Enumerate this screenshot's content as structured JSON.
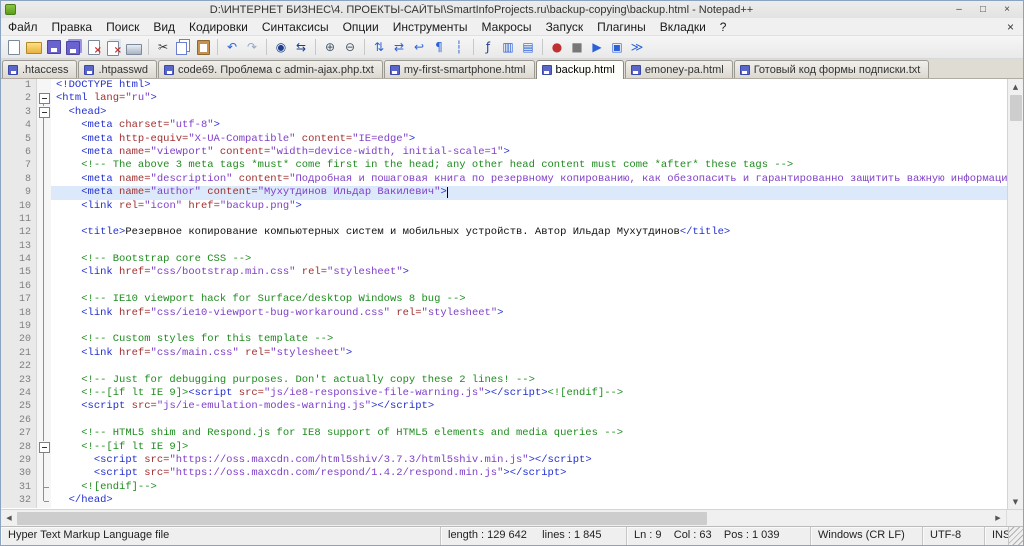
{
  "window": {
    "title": "D:\\ИНТЕРНЕТ БИЗНЕС\\4. ПРОЕКТЫ-САЙТЫ\\SmartInfoProjects.ru\\backup-copying\\backup.html - Notepad++",
    "controls": {
      "minimize": "–",
      "maximize": "□",
      "close": "×"
    }
  },
  "menu": {
    "items": [
      "Файл",
      "Правка",
      "Поиск",
      "Вид",
      "Кодировки",
      "Синтаксисы",
      "Опции",
      "Инструменты",
      "Макросы",
      "Запуск",
      "Плагины",
      "Вкладки",
      "?"
    ],
    "close_label": "×"
  },
  "toolbar": {
    "icons": [
      {
        "name": "new-file-icon",
        "type": "file"
      },
      {
        "name": "open-file-icon",
        "type": "folder"
      },
      {
        "name": "save-icon",
        "type": "floppy"
      },
      {
        "name": "save-all-icon",
        "type": "floppy-all"
      },
      {
        "name": "close-file-icon",
        "type": "file-close"
      },
      {
        "name": "close-all-icon",
        "type": "file-close-all"
      },
      {
        "name": "print-icon",
        "type": "printer"
      },
      {
        "type": "sep"
      },
      {
        "name": "cut-icon",
        "type": "glyph",
        "glyph": "✂",
        "color": "#3a3a3a"
      },
      {
        "name": "copy-icon",
        "type": "copy"
      },
      {
        "name": "paste-icon",
        "type": "clipboard"
      },
      {
        "type": "sep"
      },
      {
        "name": "undo-icon",
        "type": "glyph",
        "glyph": "↶",
        "color": "#2b62d9"
      },
      {
        "name": "redo-icon",
        "type": "glyph",
        "glyph": "↷",
        "color": "#98a8c6"
      },
      {
        "type": "sep"
      },
      {
        "name": "find-icon",
        "type": "glyph",
        "glyph": "◉",
        "color": "#1d3f8f"
      },
      {
        "name": "replace-icon",
        "type": "glyph",
        "glyph": "⇆",
        "color": "#1d3f8f"
      },
      {
        "type": "sep"
      },
      {
        "name": "zoom-in-icon",
        "type": "glyph",
        "glyph": "⊕",
        "color": "#4a5a6a"
      },
      {
        "name": "zoom-out-icon",
        "type": "glyph",
        "glyph": "⊖",
        "color": "#4a5a6a"
      },
      {
        "type": "sep"
      },
      {
        "name": "sync-vertical-icon",
        "type": "glyph",
        "glyph": "⇅",
        "color": "#2b62d9"
      },
      {
        "name": "sync-horizontal-icon",
        "type": "glyph",
        "glyph": "⇄",
        "color": "#2b62d9"
      },
      {
        "name": "word-wrap-icon",
        "type": "glyph",
        "glyph": "↩",
        "color": "#2b62d9"
      },
      {
        "name": "show-all-chars-icon",
        "type": "glyph",
        "glyph": "¶",
        "color": "#2b62d9"
      },
      {
        "name": "indent-guide-icon",
        "type": "glyph",
        "glyph": "┆",
        "color": "#2b62d9"
      },
      {
        "type": "sep"
      },
      {
        "name": "function-list-icon",
        "type": "glyph",
        "glyph": "ƒ",
        "color": "#1d3f8f"
      },
      {
        "name": "document-map-icon",
        "type": "glyph",
        "glyph": "▥",
        "color": "#2b62d9"
      },
      {
        "name": "doc-switcher-icon",
        "type": "glyph",
        "glyph": "▤",
        "color": "#2b62d9"
      },
      {
        "type": "sep"
      },
      {
        "name": "record-macro-icon",
        "type": "glyph",
        "glyph": "●",
        "color": "#c03030"
      },
      {
        "name": "stop-macro-icon",
        "type": "glyph",
        "glyph": "■",
        "color": "#777777"
      },
      {
        "name": "play-macro-icon",
        "type": "glyph",
        "glyph": "▶",
        "color": "#2b62d9"
      },
      {
        "name": "save-macro-icon",
        "type": "glyph",
        "glyph": "▣",
        "color": "#2b62d9"
      },
      {
        "name": "run-macro-multiple-icon",
        "type": "glyph",
        "glyph": "≫",
        "color": "#2b62d9"
      }
    ]
  },
  "tabs": [
    {
      "label": ".htaccess",
      "active": false
    },
    {
      "label": ".htpasswd",
      "active": false
    },
    {
      "label": "code69. Проблема с admin-ajax.php.txt",
      "active": false
    },
    {
      "label": "my-first-smartphone.html",
      "active": false
    },
    {
      "label": "backup.html",
      "active": true
    },
    {
      "label": "emoney-pa.html",
      "active": false
    },
    {
      "label": "Готовый код формы подписки.txt",
      "active": false
    }
  ],
  "editor": {
    "lines": [
      {
        "fold": "none",
        "seg": [
          [
            "t",
            "<!DOCTYPE html>"
          ]
        ]
      },
      {
        "fold": "open",
        "seg": [
          [
            "t",
            "<html "
          ],
          [
            "a",
            "lang="
          ],
          [
            "v",
            "\"ru\""
          ],
          [
            "t",
            ">"
          ]
        ]
      },
      {
        "fold": "open",
        "seg": [
          [
            "x",
            "  "
          ],
          [
            "t",
            "<head>"
          ]
        ]
      },
      {
        "fold": "line",
        "seg": [
          [
            "x",
            "    "
          ],
          [
            "t",
            "<meta "
          ],
          [
            "a",
            "charset="
          ],
          [
            "v",
            "\"utf-8\""
          ],
          [
            "t",
            ">"
          ]
        ]
      },
      {
        "fold": "line",
        "seg": [
          [
            "x",
            "    "
          ],
          [
            "t",
            "<meta "
          ],
          [
            "a",
            "http-equiv="
          ],
          [
            "v",
            "\"X-UA-Compatible\""
          ],
          [
            "x",
            " "
          ],
          [
            "a",
            "content="
          ],
          [
            "v",
            "\"IE=edge\""
          ],
          [
            "t",
            ">"
          ]
        ]
      },
      {
        "fold": "line",
        "seg": [
          [
            "x",
            "    "
          ],
          [
            "t",
            "<meta "
          ],
          [
            "a",
            "name="
          ],
          [
            "v",
            "\"viewport\""
          ],
          [
            "x",
            " "
          ],
          [
            "a",
            "content="
          ],
          [
            "v",
            "\"width=device-width, initial-scale=1\""
          ],
          [
            "t",
            ">"
          ]
        ]
      },
      {
        "fold": "line",
        "seg": [
          [
            "x",
            "    "
          ],
          [
            "c",
            "<!-- The above 3 meta tags *must* come first in the head; any other head content must come *after* these tags -->"
          ]
        ]
      },
      {
        "fold": "line",
        "seg": [
          [
            "x",
            "    "
          ],
          [
            "t",
            "<meta "
          ],
          [
            "a",
            "name="
          ],
          [
            "v",
            "\"description\""
          ],
          [
            "x",
            " "
          ],
          [
            "a",
            "content="
          ],
          [
            "v",
            "\"Подробная и пошаговая книга по резервному копированию, как обезопасить и гарантированно защитить важную информацию от внез"
          ]
        ]
      },
      {
        "fold": "line",
        "hl": true,
        "caret": true,
        "seg": [
          [
            "x",
            "    "
          ],
          [
            "t",
            "<meta "
          ],
          [
            "a",
            "name="
          ],
          [
            "v",
            "\"author\""
          ],
          [
            "x",
            " "
          ],
          [
            "a",
            "content="
          ],
          [
            "v",
            "\"Мухутдинов Ильдар Вакилевич\""
          ],
          [
            "t",
            ">"
          ]
        ]
      },
      {
        "fold": "line",
        "seg": [
          [
            "x",
            "    "
          ],
          [
            "t",
            "<link "
          ],
          [
            "a",
            "rel="
          ],
          [
            "v",
            "\"icon\""
          ],
          [
            "x",
            " "
          ],
          [
            "a",
            "href="
          ],
          [
            "v",
            "\"backup.png\""
          ],
          [
            "t",
            ">"
          ]
        ]
      },
      {
        "fold": "line",
        "seg": []
      },
      {
        "fold": "line",
        "seg": [
          [
            "x",
            "    "
          ],
          [
            "t",
            "<title>"
          ],
          [
            "x",
            "Резервное копирование компьютерных систем и мобильных устройств. Автор Ильдар Мухутдинов"
          ],
          [
            "t",
            "</title>"
          ]
        ]
      },
      {
        "fold": "line",
        "seg": []
      },
      {
        "fold": "line",
        "seg": [
          [
            "x",
            "    "
          ],
          [
            "c",
            "<!-- Bootstrap core CSS -->"
          ]
        ]
      },
      {
        "fold": "line",
        "seg": [
          [
            "x",
            "    "
          ],
          [
            "t",
            "<link "
          ],
          [
            "a",
            "href="
          ],
          [
            "v",
            "\"css/bootstrap.min.css\""
          ],
          [
            "x",
            " "
          ],
          [
            "a",
            "rel="
          ],
          [
            "v",
            "\"stylesheet\""
          ],
          [
            "t",
            ">"
          ]
        ]
      },
      {
        "fold": "line",
        "seg": []
      },
      {
        "fold": "line",
        "seg": [
          [
            "x",
            "    "
          ],
          [
            "c",
            "<!-- IE10 viewport hack for Surface/desktop Windows 8 bug -->"
          ]
        ]
      },
      {
        "fold": "line",
        "seg": [
          [
            "x",
            "    "
          ],
          [
            "t",
            "<link "
          ],
          [
            "a",
            "href="
          ],
          [
            "v",
            "\"css/ie10-viewport-bug-workaround.css\""
          ],
          [
            "x",
            " "
          ],
          [
            "a",
            "rel="
          ],
          [
            "v",
            "\"stylesheet\""
          ],
          [
            "t",
            ">"
          ]
        ]
      },
      {
        "fold": "line",
        "seg": []
      },
      {
        "fold": "line",
        "seg": [
          [
            "x",
            "    "
          ],
          [
            "c",
            "<!-- Custom styles for this template -->"
          ]
        ]
      },
      {
        "fold": "line",
        "seg": [
          [
            "x",
            "    "
          ],
          [
            "t",
            "<link "
          ],
          [
            "a",
            "href="
          ],
          [
            "v",
            "\"css/main.css\""
          ],
          [
            "x",
            " "
          ],
          [
            "a",
            "rel="
          ],
          [
            "v",
            "\"stylesheet\""
          ],
          [
            "t",
            ">"
          ]
        ]
      },
      {
        "fold": "line",
        "seg": []
      },
      {
        "fold": "line",
        "seg": [
          [
            "x",
            "    "
          ],
          [
            "c",
            "<!-- Just for debugging purposes. Don't actually copy these 2 lines! -->"
          ]
        ]
      },
      {
        "fold": "line",
        "seg": [
          [
            "x",
            "    "
          ],
          [
            "c",
            "<!--[if lt IE 9]>"
          ],
          [
            "t",
            "<script "
          ],
          [
            "a",
            "src="
          ],
          [
            "v",
            "\"js/ie8-responsive-file-warning.js\""
          ],
          [
            "t",
            "></script>"
          ],
          [
            "c",
            "<![endif]-->"
          ]
        ]
      },
      {
        "fold": "line",
        "seg": [
          [
            "x",
            "    "
          ],
          [
            "t",
            "<script "
          ],
          [
            "a",
            "src="
          ],
          [
            "v",
            "\"js/ie-emulation-modes-warning.js\""
          ],
          [
            "t",
            "></script>"
          ]
        ]
      },
      {
        "fold": "line",
        "seg": []
      },
      {
        "fold": "line",
        "seg": [
          [
            "x",
            "    "
          ],
          [
            "c",
            "<!-- HTML5 shim and Respond.js for IE8 support of HTML5 elements and media queries -->"
          ]
        ]
      },
      {
        "fold": "open",
        "seg": [
          [
            "x",
            "    "
          ],
          [
            "c",
            "<!--[if lt IE 9]>"
          ]
        ]
      },
      {
        "fold": "line",
        "seg": [
          [
            "x",
            "      "
          ],
          [
            "t",
            "<script "
          ],
          [
            "a",
            "src="
          ],
          [
            "v",
            "\"https://oss.maxcdn.com/html5shiv/3.7.3/html5shiv.min.js\""
          ],
          [
            "t",
            "></script>"
          ]
        ]
      },
      {
        "fold": "line",
        "seg": [
          [
            "x",
            "      "
          ],
          [
            "t",
            "<script "
          ],
          [
            "a",
            "src="
          ],
          [
            "v",
            "\"https://oss.maxcdn.com/respond/1.4.2/respond.min.js\""
          ],
          [
            "t",
            "></script>"
          ]
        ]
      },
      {
        "fold": "tee",
        "seg": [
          [
            "x",
            "    "
          ],
          [
            "c",
            "<![endif]-->"
          ]
        ]
      },
      {
        "fold": "end",
        "seg": [
          [
            "x",
            "  "
          ],
          [
            "t",
            "</head>"
          ]
        ]
      }
    ]
  },
  "scrollbars": {
    "up": "▲",
    "down": "▼",
    "left": "◀",
    "right": "▶"
  },
  "statusbar": {
    "doc_type": "Hyper Text Markup Language file",
    "length_lines": "length : 129 642     lines : 1 845",
    "cursor_position": "Ln : 9    Col : 63    Pos : 1 039",
    "eol_format": "Windows (CR LF)",
    "encoding": "UTF-8",
    "insert_mode": "INS"
  }
}
